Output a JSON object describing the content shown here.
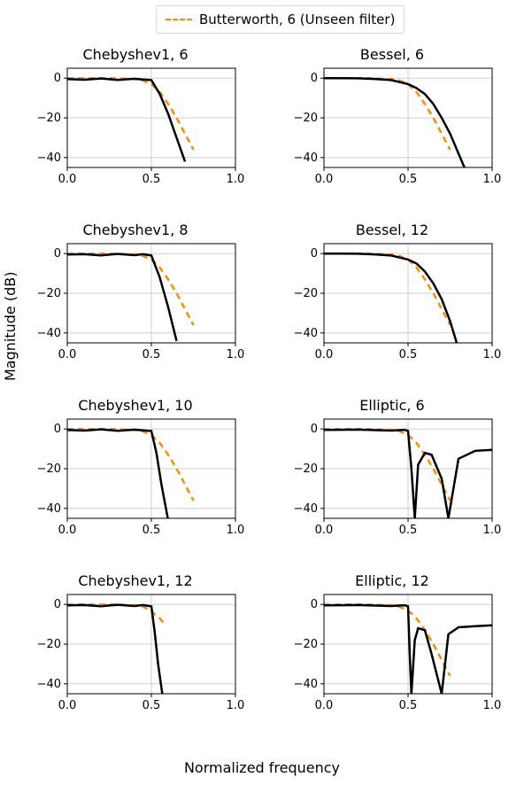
{
  "legend_label": "Butterworth, 6 (Unseen filter)",
  "ylabel": "Magnitude (dB)",
  "xlabel": "Normalized frequency",
  "x_ticks": [
    0.0,
    0.5,
    1.0
  ],
  "y_ticks": [
    0,
    -20,
    -40
  ],
  "charts": [
    {
      "title": "Chebyshev1, 6",
      "series_id": "cheb6"
    },
    {
      "title": "Bessel, 6",
      "series_id": "bes6"
    },
    {
      "title": "Chebyshev1, 8",
      "series_id": "cheb8"
    },
    {
      "title": "Bessel, 12",
      "series_id": "bes12"
    },
    {
      "title": "Chebyshev1, 10",
      "series_id": "cheb10"
    },
    {
      "title": "Elliptic, 6",
      "series_id": "ell6"
    },
    {
      "title": "Chebyshev1, 12",
      "series_id": "cheb12"
    },
    {
      "title": "Elliptic, 12",
      "series_id": "ell12"
    }
  ],
  "chart_data": [
    {
      "type": "line",
      "title": "Chebyshev1, 6",
      "xlabel": "Normalized frequency",
      "ylabel": "Magnitude (dB)",
      "xlim": [
        0.0,
        1.0
      ],
      "ylim": [
        -45,
        5
      ],
      "series": [
        {
          "name": "Butterworth, 6 (Unseen filter)",
          "style": "dashed",
          "color": "#ff8c00",
          "x": [
            0.0,
            0.1,
            0.2,
            0.3,
            0.4,
            0.45,
            0.5,
            0.55,
            0.6,
            0.65,
            0.7,
            0.75
          ],
          "y": [
            0.0,
            0.0,
            0.0,
            -0.1,
            -0.5,
            -1.2,
            -3.0,
            -7.0,
            -13.0,
            -20.0,
            -28.0,
            -36.0
          ]
        },
        {
          "name": "Chebyshev1, 6",
          "style": "solid",
          "color": "#000000",
          "x": [
            0.0,
            0.1,
            0.2,
            0.3,
            0.4,
            0.45,
            0.5,
            0.55,
            0.6,
            0.65,
            0.7
          ],
          "y": [
            -0.5,
            -0.8,
            -0.2,
            -0.9,
            -0.3,
            -0.7,
            -1.0,
            -8.0,
            -18.0,
            -30.0,
            -42.0
          ]
        }
      ]
    },
    {
      "type": "line",
      "title": "Bessel, 6",
      "xlabel": "Normalized frequency",
      "ylabel": "Magnitude (dB)",
      "xlim": [
        0.0,
        1.0
      ],
      "ylim": [
        -45,
        5
      ],
      "series": [
        {
          "name": "Butterworth, 6 (Unseen filter)",
          "style": "dashed",
          "color": "#ff8c00",
          "x": [
            0.0,
            0.1,
            0.2,
            0.3,
            0.4,
            0.45,
            0.5,
            0.55,
            0.6,
            0.65,
            0.7,
            0.75
          ],
          "y": [
            0.0,
            0.0,
            0.0,
            -0.1,
            -0.5,
            -1.2,
            -3.0,
            -7.0,
            -13.0,
            -20.0,
            -28.0,
            -36.0
          ]
        },
        {
          "name": "Bessel, 6",
          "style": "solid",
          "color": "#000000",
          "x": [
            0.0,
            0.1,
            0.2,
            0.3,
            0.4,
            0.5,
            0.55,
            0.6,
            0.65,
            0.7,
            0.75,
            0.8,
            0.85
          ],
          "y": [
            0.0,
            0.0,
            -0.1,
            -0.4,
            -1.0,
            -3.0,
            -5.0,
            -8.0,
            -13.0,
            -20.0,
            -28.0,
            -38.0,
            -48.0
          ]
        }
      ]
    },
    {
      "type": "line",
      "title": "Chebyshev1, 8",
      "xlabel": "Normalized frequency",
      "ylabel": "Magnitude (dB)",
      "xlim": [
        0.0,
        1.0
      ],
      "ylim": [
        -45,
        5
      ],
      "series": [
        {
          "name": "Butterworth, 6 (Unseen filter)",
          "style": "dashed",
          "color": "#ff8c00",
          "x": [
            0.0,
            0.1,
            0.2,
            0.3,
            0.4,
            0.45,
            0.5,
            0.55,
            0.6,
            0.65,
            0.7,
            0.75
          ],
          "y": [
            0.0,
            0.0,
            0.0,
            -0.1,
            -0.5,
            -1.2,
            -3.0,
            -7.0,
            -13.0,
            -20.0,
            -28.0,
            -36.0
          ]
        },
        {
          "name": "Chebyshev1, 8",
          "style": "solid",
          "color": "#000000",
          "x": [
            0.0,
            0.1,
            0.2,
            0.3,
            0.4,
            0.45,
            0.5,
            0.55,
            0.6,
            0.65
          ],
          "y": [
            -0.5,
            -0.3,
            -0.9,
            -0.2,
            -0.8,
            -0.3,
            -1.0,
            -12.0,
            -27.0,
            -44.0
          ]
        }
      ]
    },
    {
      "type": "line",
      "title": "Bessel, 12",
      "xlabel": "Normalized frequency",
      "ylabel": "Magnitude (dB)",
      "xlim": [
        0.0,
        1.0
      ],
      "ylim": [
        -45,
        5
      ],
      "series": [
        {
          "name": "Butterworth, 6 (Unseen filter)",
          "style": "dashed",
          "color": "#ff8c00",
          "x": [
            0.0,
            0.1,
            0.2,
            0.3,
            0.4,
            0.45,
            0.5,
            0.55,
            0.6,
            0.65,
            0.7,
            0.75
          ],
          "y": [
            0.0,
            0.0,
            0.0,
            -0.1,
            -0.5,
            -1.2,
            -3.0,
            -7.0,
            -13.0,
            -20.0,
            -28.0,
            -36.0
          ]
        },
        {
          "name": "Bessel, 12",
          "style": "solid",
          "color": "#000000",
          "x": [
            0.0,
            0.1,
            0.2,
            0.3,
            0.4,
            0.5,
            0.55,
            0.6,
            0.65,
            0.7,
            0.75,
            0.8
          ],
          "y": [
            0.0,
            0.0,
            -0.1,
            -0.4,
            -1.0,
            -3.0,
            -5.0,
            -9.0,
            -15.0,
            -23.0,
            -34.0,
            -48.0
          ]
        }
      ]
    },
    {
      "type": "line",
      "title": "Chebyshev1, 10",
      "xlabel": "Normalized frequency",
      "ylabel": "Magnitude (dB)",
      "xlim": [
        0.0,
        1.0
      ],
      "ylim": [
        -45,
        5
      ],
      "series": [
        {
          "name": "Butterworth, 6 (Unseen filter)",
          "style": "dashed",
          "color": "#ff8c00",
          "x": [
            0.0,
            0.1,
            0.2,
            0.3,
            0.4,
            0.45,
            0.5,
            0.55,
            0.6,
            0.65,
            0.7,
            0.75
          ],
          "y": [
            0.0,
            0.0,
            0.0,
            -0.1,
            -0.5,
            -1.2,
            -3.0,
            -7.0,
            -13.0,
            -20.0,
            -28.0,
            -36.0
          ]
        },
        {
          "name": "Chebyshev1, 10",
          "style": "solid",
          "color": "#000000",
          "x": [
            0.0,
            0.1,
            0.2,
            0.3,
            0.4,
            0.45,
            0.5,
            0.53,
            0.56,
            0.6
          ],
          "y": [
            -0.5,
            -0.8,
            -0.2,
            -0.9,
            -0.3,
            -0.7,
            -1.0,
            -12.0,
            -28.0,
            -46.0
          ]
        }
      ]
    },
    {
      "type": "line",
      "title": "Elliptic, 6",
      "xlabel": "Normalized frequency",
      "ylabel": "Magnitude (dB)",
      "xlim": [
        0.0,
        1.0
      ],
      "ylim": [
        -45,
        5
      ],
      "series": [
        {
          "name": "Butterworth, 6 (Unseen filter)",
          "style": "dashed",
          "color": "#ff8c00",
          "x": [
            0.0,
            0.1,
            0.2,
            0.3,
            0.4,
            0.45,
            0.5,
            0.55,
            0.6,
            0.65,
            0.7,
            0.75
          ],
          "y": [
            0.0,
            0.0,
            0.0,
            -0.1,
            -0.5,
            -1.2,
            -3.0,
            -7.0,
            -13.0,
            -20.0,
            -28.0,
            -36.0
          ]
        },
        {
          "name": "Elliptic, 6",
          "style": "solid",
          "color": "#000000",
          "x": [
            0.0,
            0.2,
            0.4,
            0.48,
            0.5,
            0.52,
            0.54,
            0.56,
            0.6,
            0.64,
            0.7,
            0.74,
            0.8,
            0.9,
            1.0
          ],
          "y": [
            -0.5,
            -0.3,
            -0.8,
            -0.4,
            -1.0,
            -20.0,
            -45.0,
            -18.0,
            -12.0,
            -13.0,
            -25.0,
            -45.0,
            -15.0,
            -11.0,
            -10.5
          ]
        }
      ]
    },
    {
      "type": "line",
      "title": "Chebyshev1, 12",
      "xlabel": "Normalized frequency",
      "ylabel": "Magnitude (dB)",
      "xlim": [
        0.0,
        1.0
      ],
      "ylim": [
        -45,
        5
      ],
      "series": [
        {
          "name": "Butterworth, 6 (Unseen filter)",
          "style": "dashed",
          "color": "#ff8c00",
          "x": [
            0.0,
            0.1,
            0.2,
            0.3,
            0.4,
            0.45,
            0.5,
            0.52,
            0.55,
            0.58
          ],
          "y": [
            0.0,
            0.0,
            0.0,
            -0.1,
            -0.5,
            -1.2,
            -3.0,
            -5.0,
            -7.0,
            -10.0
          ]
        },
        {
          "name": "Chebyshev1, 12",
          "style": "solid",
          "color": "#000000",
          "x": [
            0.0,
            0.1,
            0.2,
            0.3,
            0.4,
            0.45,
            0.5,
            0.52,
            0.54,
            0.57
          ],
          "y": [
            -0.5,
            -0.3,
            -0.9,
            -0.2,
            -0.8,
            -0.3,
            -1.0,
            -14.0,
            -30.0,
            -48.0
          ]
        }
      ]
    },
    {
      "type": "line",
      "title": "Elliptic, 12",
      "xlabel": "Normalized frequency",
      "ylabel": "Magnitude (dB)",
      "xlim": [
        0.0,
        1.0
      ],
      "ylim": [
        -45,
        5
      ],
      "series": [
        {
          "name": "Butterworth, 6 (Unseen filter)",
          "style": "dashed",
          "color": "#ff8c00",
          "x": [
            0.0,
            0.1,
            0.2,
            0.3,
            0.4,
            0.45,
            0.5,
            0.55,
            0.6,
            0.65,
            0.7,
            0.75
          ],
          "y": [
            0.0,
            0.0,
            0.0,
            -0.1,
            -0.5,
            -1.2,
            -3.0,
            -7.0,
            -13.0,
            -20.0,
            -28.0,
            -36.0
          ]
        },
        {
          "name": "Elliptic, 12",
          "style": "solid",
          "color": "#000000",
          "x": [
            0.0,
            0.2,
            0.4,
            0.48,
            0.5,
            0.51,
            0.52,
            0.54,
            0.56,
            0.6,
            0.64,
            0.7,
            0.74,
            0.8,
            0.9,
            1.0
          ],
          "y": [
            -0.5,
            -0.3,
            -0.8,
            -0.4,
            -1.0,
            -25.0,
            -45.0,
            -18.0,
            -12.0,
            -13.0,
            -25.0,
            -45.0,
            -15.0,
            -11.5,
            -11.0,
            -10.5
          ]
        }
      ]
    }
  ]
}
